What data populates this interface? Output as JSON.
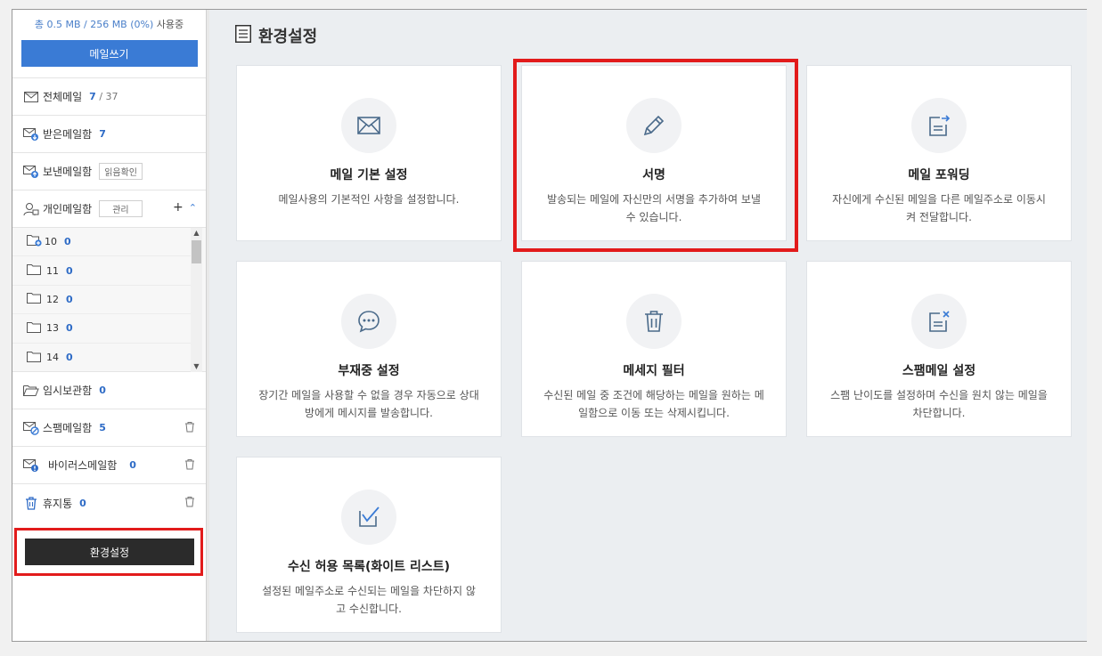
{
  "sidebar": {
    "usage": {
      "text": "총 0.5 MB / 256 MB (0%)",
      "suffix": " 사용중"
    },
    "compose_label": "메일쓰기",
    "mailboxes": {
      "all": {
        "label": "전체메일",
        "count": "7",
        "total": " / 37"
      },
      "inbox": {
        "label": "받은메일함",
        "count": "7"
      },
      "sent": {
        "label": "보낸메일함",
        "tag": "읽음확인"
      },
      "personal": {
        "label": "개인메일함",
        "tag": "관리",
        "add": "+",
        "collapse": "^"
      },
      "drafts": {
        "label": "임시보관함",
        "count": "0"
      },
      "spam": {
        "label": "스팸메일함",
        "count": "5"
      },
      "virus": {
        "label": "바이러스메일함",
        "count": "0"
      },
      "trash": {
        "label": "휴지통",
        "count": "0"
      }
    },
    "folders": [
      {
        "name": "10",
        "count": "0"
      },
      {
        "name": "11",
        "count": "0"
      },
      {
        "name": "12",
        "count": "0"
      },
      {
        "name": "13",
        "count": "0"
      },
      {
        "name": "14",
        "count": "0"
      }
    ],
    "settings_label": "환경설정"
  },
  "main": {
    "title": "환경설정",
    "cards": [
      {
        "title": "메일 기본 설정",
        "desc": "메일사용의 기본적인 사항을 설정합니다.",
        "icon": "envelope-icon"
      },
      {
        "title": "서명",
        "desc": "발송되는 메일에 자신만의 서명을 추가하여 보낼 수 있습니다.",
        "icon": "pencil-icon"
      },
      {
        "title": "메일 포워딩",
        "desc": "자신에게 수신된 메일을 다른 메일주소로 이동시켜 전달합니다.",
        "icon": "forward-icon"
      },
      {
        "title": "부재중 설정",
        "desc": "장기간 메일을 사용할 수 없을 경우 자동으로 상대방에게 메시지를 발송합니다.",
        "icon": "chat-bubble-icon"
      },
      {
        "title": "메세지 필터",
        "desc": "수신된 메일 중 조건에 해당하는 메일을 원하는 메일함으로 이동 또는 삭제시킵니다.",
        "icon": "trash-icon"
      },
      {
        "title": "스팸메일 설정",
        "desc": "스팸 난이도를 설정하며 수신을 원치 않는 메일을 차단합니다.",
        "icon": "spam-icon"
      },
      {
        "title": "수신 허용 목록(화이트 리스트)",
        "desc": "설정된 메일주소로 수신되는 메일을 차단하지 않고 수신합니다.",
        "icon": "checkbox-icon"
      }
    ]
  },
  "colors": {
    "accent": "#3a7bd5",
    "highlight": "#e21b1b",
    "count": "#2e6bc6"
  }
}
